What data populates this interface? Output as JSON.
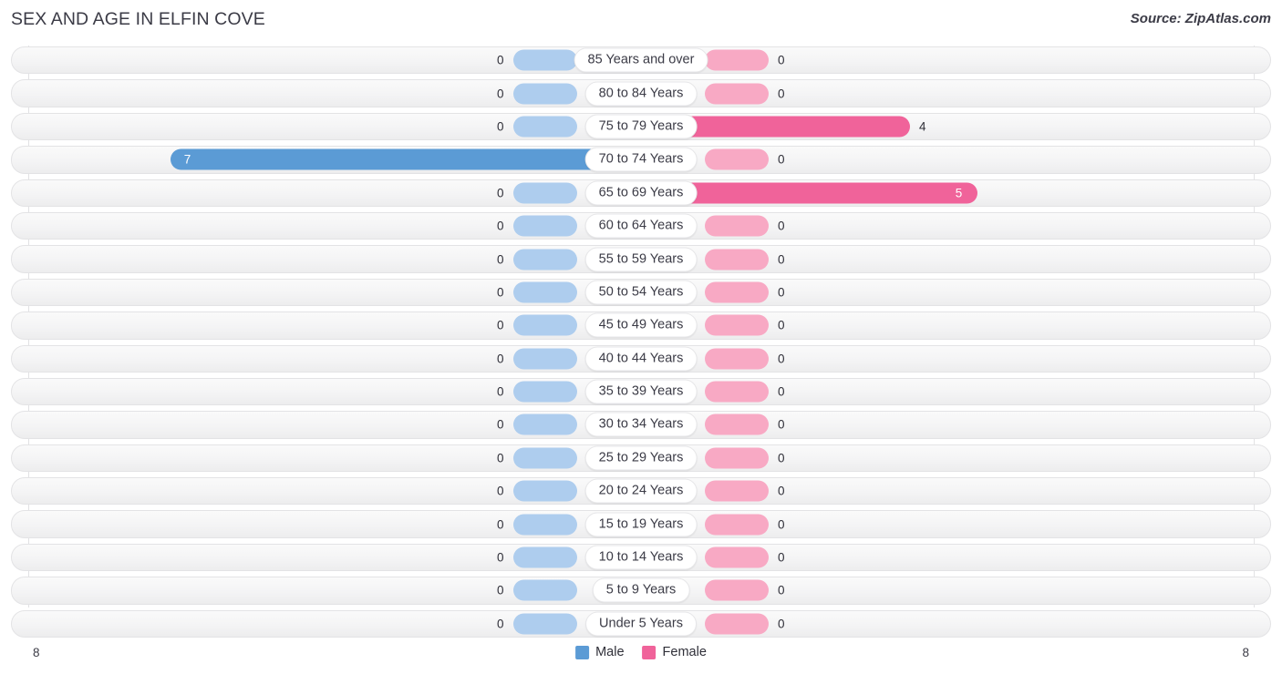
{
  "header": {
    "title": "SEX AND AGE IN ELFIN COVE",
    "source": "Source: ZipAtlas.com"
  },
  "legend": {
    "male_label": "Male",
    "female_label": "Female",
    "male_color": "#5B9BD5",
    "female_color": "#F0639A"
  },
  "axis": {
    "left_label": "8",
    "right_label": "8"
  },
  "colors": {
    "male_filled": "#5B9BD5",
    "male_empty": "#AECDEE",
    "female_filled": "#F0639A",
    "female_empty": "#F8A9C4",
    "row_background": "#F4F4F5",
    "row_border": "#E3E3E5",
    "text": "#3B3B46"
  },
  "chart_data": {
    "type": "bar",
    "subtype": "population-pyramid",
    "title": "SEX AND AGE IN ELFIN COVE",
    "xlabel": "",
    "ylabel": "",
    "axis_max": 8,
    "xlim": [
      8,
      8
    ],
    "grid": true,
    "legend_position": "bottom-center",
    "categories": [
      "85 Years and over",
      "80 to 84 Years",
      "75 to 79 Years",
      "70 to 74 Years",
      "65 to 69 Years",
      "60 to 64 Years",
      "55 to 59 Years",
      "50 to 54 Years",
      "45 to 49 Years",
      "40 to 44 Years",
      "35 to 39 Years",
      "30 to 34 Years",
      "25 to 29 Years",
      "20 to 24 Years",
      "15 to 19 Years",
      "10 to 14 Years",
      "5 to 9 Years",
      "Under 5 Years"
    ],
    "series": [
      {
        "name": "Male",
        "color": "#5B9BD5",
        "values": [
          0,
          0,
          0,
          7,
          0,
          0,
          0,
          0,
          0,
          0,
          0,
          0,
          0,
          0,
          0,
          0,
          0,
          0
        ]
      },
      {
        "name": "Female",
        "color": "#F0639A",
        "values": [
          0,
          0,
          4,
          0,
          5,
          0,
          0,
          0,
          0,
          0,
          0,
          0,
          0,
          0,
          0,
          0,
          0,
          0
        ]
      }
    ]
  }
}
